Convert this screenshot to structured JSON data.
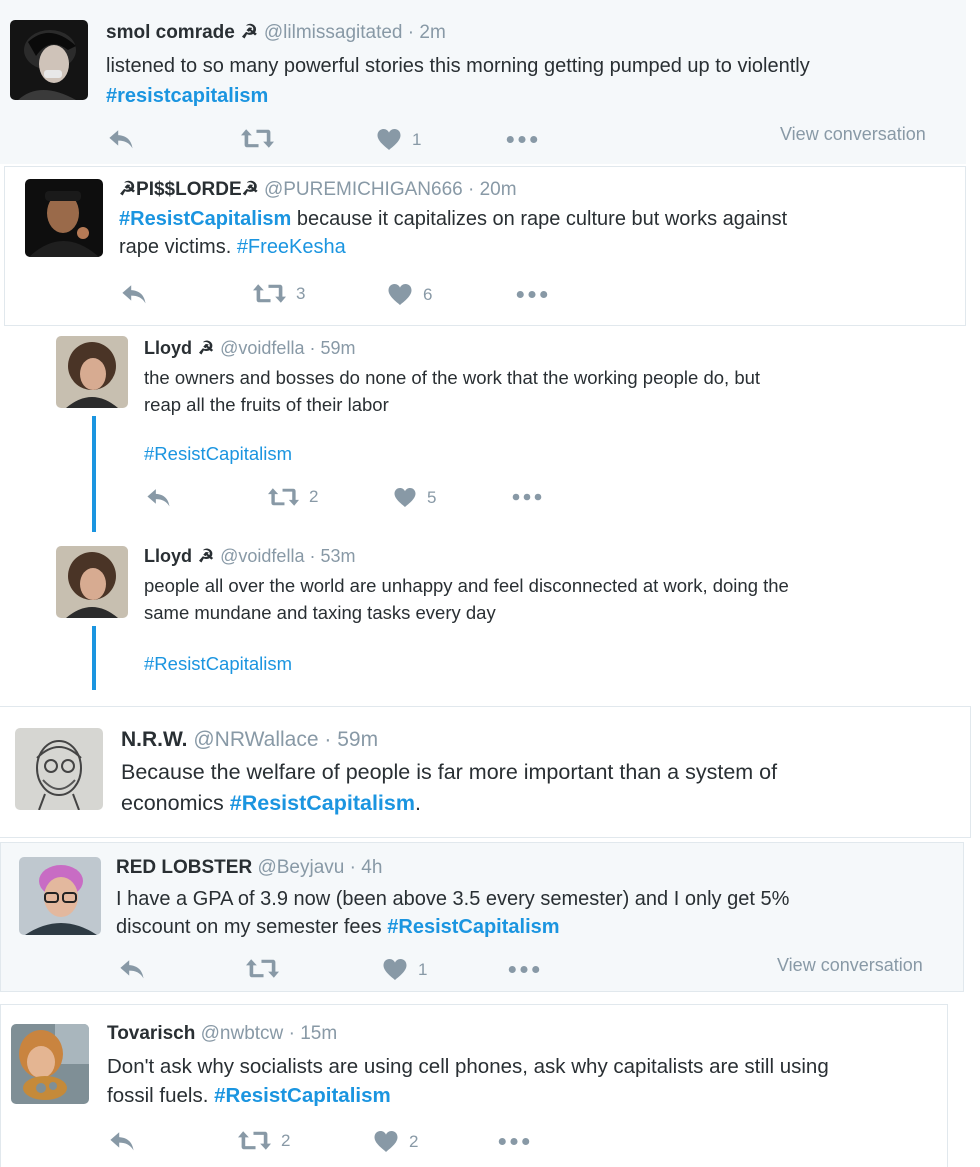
{
  "tweets": [
    {
      "name": "smol comrade",
      "glyph": "☭",
      "handle": "@lilmissagitated",
      "sep": "·",
      "time": "2m",
      "text": "listened to so many powerful stories this morning getting pumped up to violently",
      "hashtag": "#resistcapitalism",
      "likes": "1",
      "view_conversation": "View conversation"
    },
    {
      "name": "☭PI$$LORDE☭",
      "handle": "@PUREMICHIGAN666",
      "sep": "·",
      "time": "20m",
      "hashtag": "#ResistCapitalism",
      "text": "because it capitalizes on rape culture but works against",
      "text2": "rape victims.",
      "hashtag2": "#FreeKesha",
      "retweets": "3",
      "likes": "6"
    },
    {
      "name": "Lloyd",
      "glyph": "☭",
      "handle": "@voidfella",
      "sep": "·",
      "time": "59m",
      "line1": "the owners and bosses do none of the work that the working people do, but",
      "line2": "reap all the fruits of their labor",
      "hashtag": "#ResistCapitalism",
      "retweets": "2",
      "likes": "5"
    },
    {
      "name": "Lloyd",
      "glyph": "☭",
      "handle": "@voidfella",
      "sep": "·",
      "time": "53m",
      "line1": "people all over the world are unhappy and feel disconnected at work, doing the",
      "line2": "same mundane and taxing tasks every day",
      "hashtag": "#ResistCapitalism"
    },
    {
      "name": "N.R.W.",
      "handle": "@NRWallace",
      "sep": "·",
      "time": "59m",
      "line1": "Because the welfare of people is far more important than a system of",
      "line2": "economics",
      "hashtag": "#ResistCapitalism",
      "punct": "."
    },
    {
      "name": "RED LOBSTER",
      "handle": "@Beyjavu",
      "sep": "·",
      "time": "4h",
      "line1": "I have a GPA of 3.9 now (been above 3.5 every semester) and I only get 5%",
      "line2": "discount on my semester fees",
      "hashtag": "#ResistCapitalism",
      "likes": "1",
      "view_conversation": "View conversation"
    },
    {
      "name": "Tovarisch",
      "handle": "@nwbtcw",
      "sep": "·",
      "time": "15m",
      "line1": "Don't ask why socialists are using cell phones, ask why capitalists are still using",
      "line2": "fossil fuels.",
      "hashtag": "#ResistCapitalism",
      "retweets": "2",
      "likes": "2"
    }
  ],
  "icons": {
    "reply": "reply-icon",
    "retweet": "retweet-icon",
    "like": "heart-icon",
    "more": "more-icon"
  },
  "colors": {
    "link": "#1b95e0",
    "muted": "#8899a6",
    "text": "#292f33",
    "thread": "#1b95e0"
  }
}
